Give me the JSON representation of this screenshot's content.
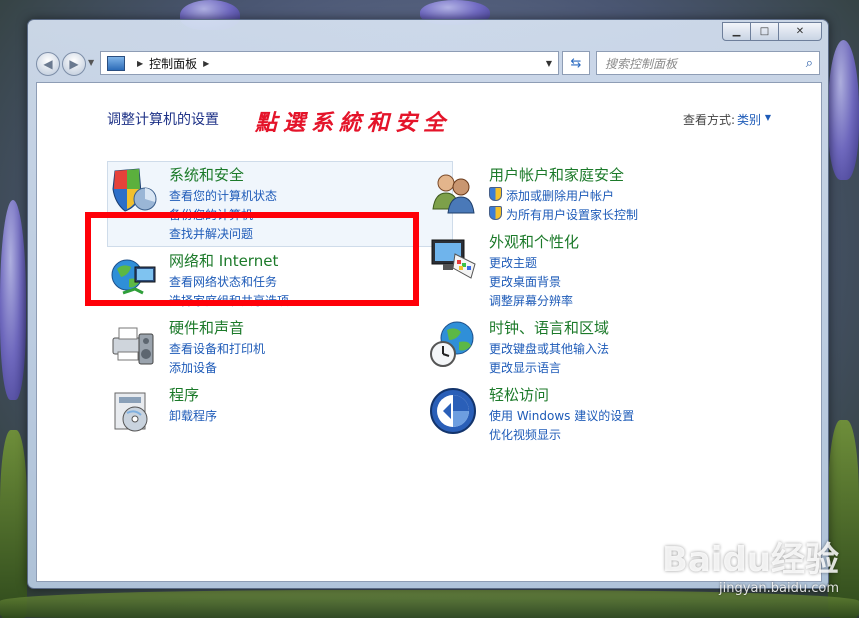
{
  "address": {
    "root_label": "控制面板"
  },
  "search": {
    "placeholder": "搜索控制面板"
  },
  "content": {
    "heading": "调整计算机的设置",
    "annotation": "點選系統和安全",
    "view_by_label": "查看方式:",
    "view_by_value": "类别"
  },
  "left_categories": [
    {
      "title": "系统和安全",
      "icon": "shield-pie-icon",
      "links": [
        "查看您的计算机状态",
        "备份您的计算机",
        "查找并解决问题"
      ]
    },
    {
      "title": "网络和 Internet",
      "icon": "globe-network-icon",
      "links": [
        "查看网络状态和任务",
        "选择家庭组和共享选项"
      ]
    },
    {
      "title": "硬件和声音",
      "icon": "printer-speaker-icon",
      "links": [
        "查看设备和打印机",
        "添加设备"
      ]
    },
    {
      "title": "程序",
      "icon": "program-disc-icon",
      "links": [
        "卸载程序"
      ]
    }
  ],
  "right_categories": [
    {
      "title": "用户帐户和家庭安全",
      "icon": "users-icon",
      "links": [
        "添加或删除用户帐户",
        "为所有用户设置家长控制"
      ]
    },
    {
      "title": "外观和个性化",
      "icon": "monitor-palette-icon",
      "links": [
        "更改主题",
        "更改桌面背景",
        "调整屏幕分辨率"
      ]
    },
    {
      "title": "时钟、语言和区域",
      "icon": "clock-globe-icon",
      "links": [
        "更改键盘或其他输入法",
        "更改显示语言"
      ]
    },
    {
      "title": "轻松访问",
      "icon": "ease-of-access-icon",
      "links": [
        "使用 Windows 建议的设置",
        "优化视频显示"
      ]
    }
  ],
  "watermark": {
    "logo": "Baidu经验",
    "url": "jingyan.baidu.com"
  }
}
